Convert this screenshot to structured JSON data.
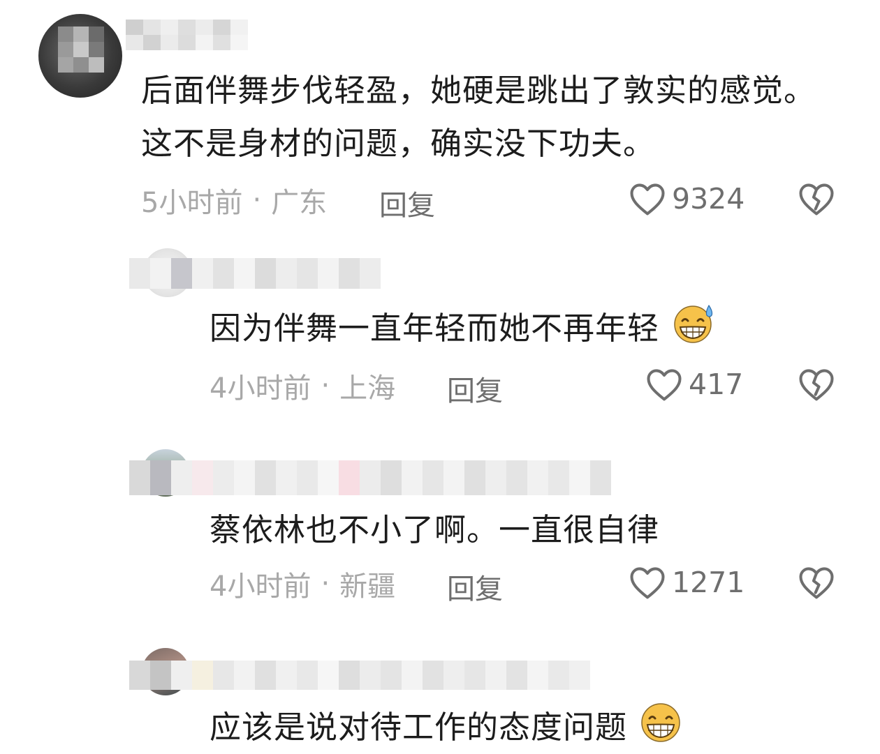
{
  "comments": [
    {
      "text": "后面伴舞步伐轻盈，她硬是跳出了敦实的感觉。这不是身材的问题，确实没下功夫。",
      "time": "5小时前",
      "separator": "·",
      "location": "广东",
      "reply_label": "回复",
      "likes": "9324"
    },
    {
      "text": "因为伴舞一直年轻而她不再年轻",
      "time": "4小时前",
      "separator": "·",
      "location": "上海",
      "reply_label": "回复",
      "likes": "417",
      "emoji": "grinning-sweat"
    },
    {
      "text": "蔡依林也不小了啊。一直很自律",
      "time": "4小时前",
      "separator": "·",
      "location": "新疆",
      "reply_label": "回复",
      "likes": "1271"
    },
    {
      "text": "应该是说对待工作的态度问题",
      "emoji": "grinning"
    }
  ],
  "icons": {
    "like": "heart-outline-icon",
    "dislike": "broken-heart-icon",
    "emoji_sweat": "grinning-sweat-emoji-icon",
    "emoji_grin": "grinning-emoji-icon"
  },
  "colors": {
    "text": "#1c1c1c",
    "meta": "#a8a8a8",
    "action": "#6e6e6e",
    "emoji_face": "#f6c24a"
  }
}
